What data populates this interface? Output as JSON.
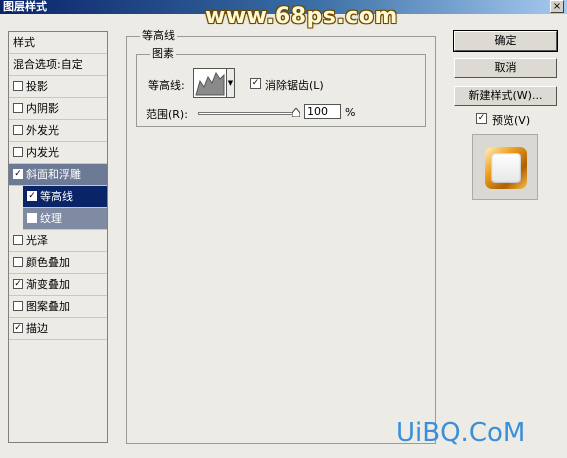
{
  "window": {
    "title": "图层样式",
    "close_glyph": "×"
  },
  "watermarks": {
    "top": "www.68ps.com",
    "bottom": "UiBQ.CoM"
  },
  "styles_list": {
    "items": [
      {
        "label": "样式",
        "has_checkbox": false,
        "checked": false
      },
      {
        "label": "混合选项:自定",
        "has_checkbox": false,
        "checked": false
      },
      {
        "label": "投影",
        "has_checkbox": true,
        "checked": false
      },
      {
        "label": "内阴影",
        "has_checkbox": true,
        "checked": false
      },
      {
        "label": "外发光",
        "has_checkbox": true,
        "checked": false
      },
      {
        "label": "内发光",
        "has_checkbox": true,
        "checked": false
      },
      {
        "label": "斜面和浮雕",
        "has_checkbox": true,
        "checked": true,
        "state": "selected"
      },
      {
        "label": "等高线",
        "has_checkbox": true,
        "checked": true,
        "state": "sub-selected"
      },
      {
        "label": "纹理",
        "has_checkbox": true,
        "checked": false,
        "state": "sub"
      },
      {
        "label": "光泽",
        "has_checkbox": true,
        "checked": false
      },
      {
        "label": "颜色叠加",
        "has_checkbox": true,
        "checked": false
      },
      {
        "label": "渐变叠加",
        "has_checkbox": true,
        "checked": true
      },
      {
        "label": "图案叠加",
        "has_checkbox": true,
        "checked": false
      },
      {
        "label": "描边",
        "has_checkbox": true,
        "checked": true
      }
    ],
    "check_glyph": "✓"
  },
  "contour_panel": {
    "group_title": "等高线",
    "subgroup_title": "图素",
    "contour_label": "等高线:",
    "anti_alias_label": "消除锯齿(L)",
    "anti_alias_checked": true,
    "range_label": "范围(R):",
    "range_value": "100",
    "range_unit": "%",
    "range_percent": 100
  },
  "buttons": {
    "ok": "确定",
    "cancel": "取消",
    "new_style": "新建样式(W)...",
    "preview_label": "预览(V)",
    "preview_checked": true
  }
}
